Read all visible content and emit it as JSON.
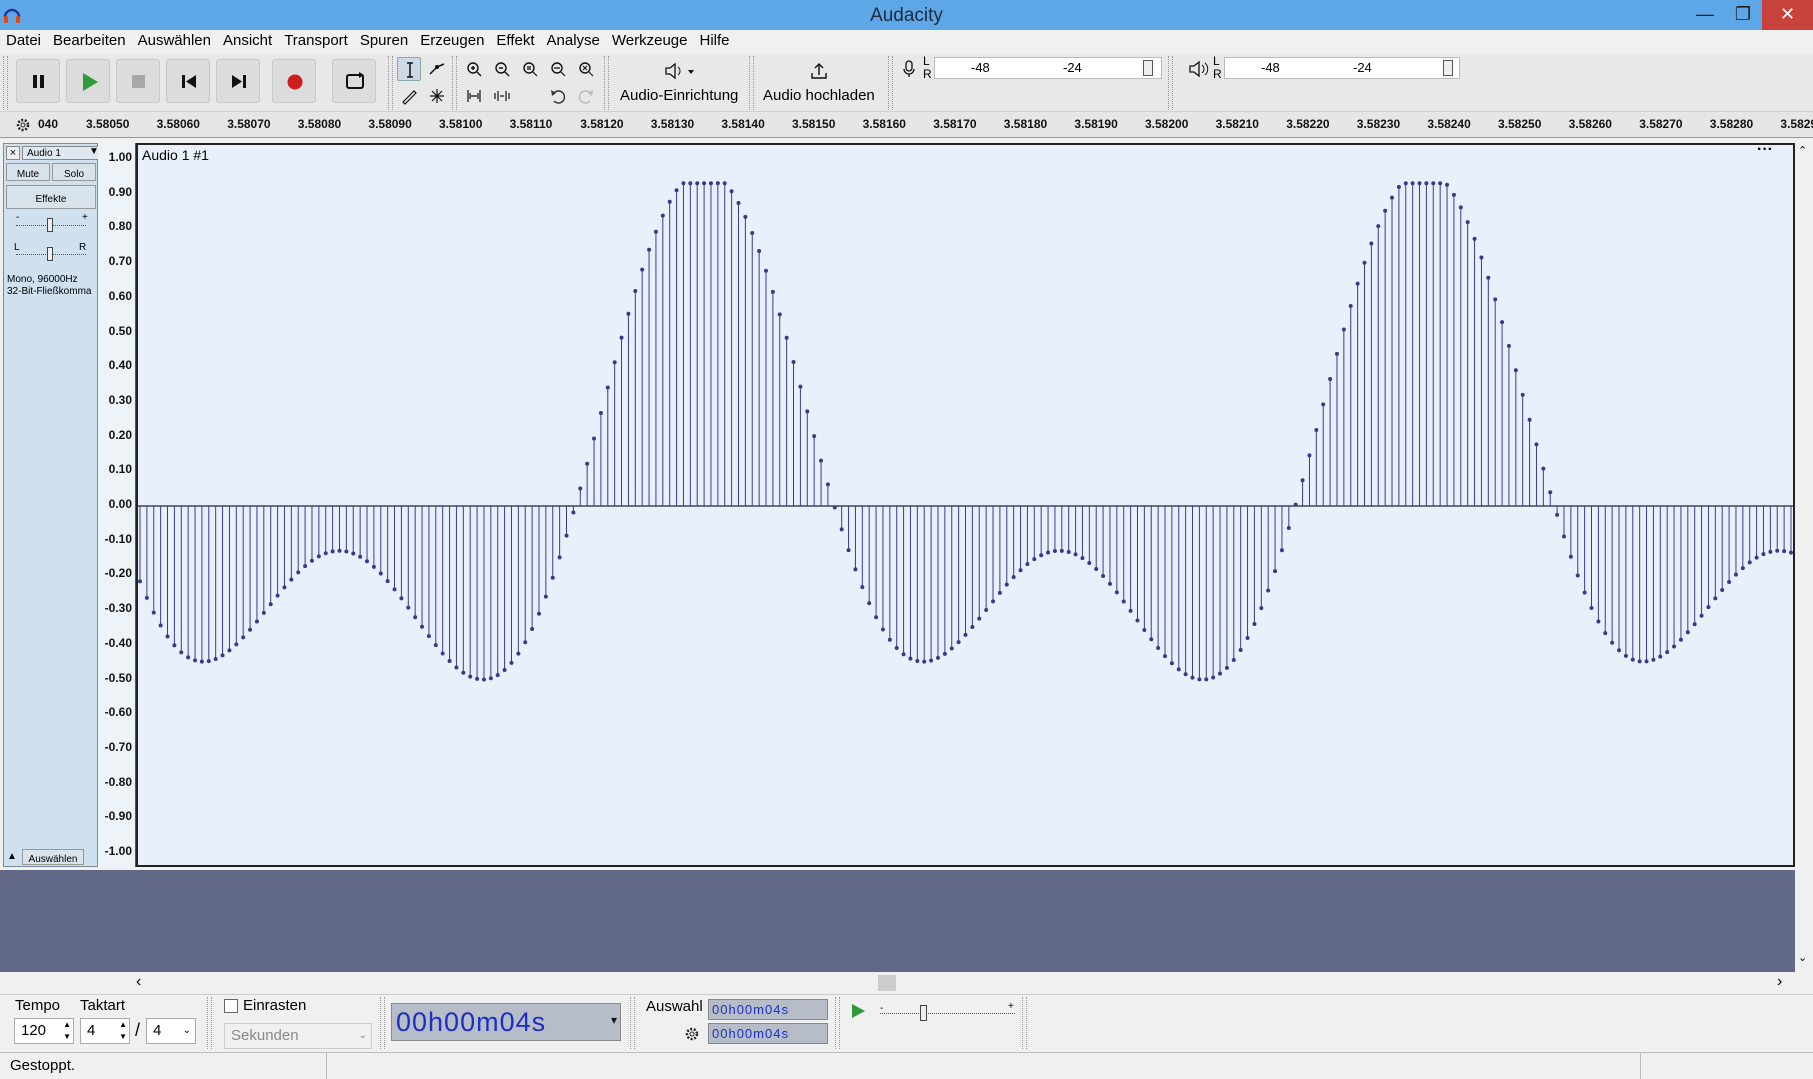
{
  "window": {
    "title": "Audacity",
    "min": "—",
    "max": "❐",
    "close": "✕"
  },
  "menu": [
    "Datei",
    "Bearbeiten",
    "Auswählen",
    "Ansicht",
    "Transport",
    "Spuren",
    "Erzeugen",
    "Effekt",
    "Analyse",
    "Werkzeuge",
    "Hilfe"
  ],
  "toolbar": {
    "audio_setup_label": "Audio-Einrichtung",
    "audio_upload_label": "Audio hochladen",
    "meter_rec_ticks": [
      "-48",
      "-24"
    ],
    "meter_play_ticks": [
      "-48",
      "-24"
    ],
    "lr_l": "L",
    "lr_r": "R"
  },
  "ruler": {
    "labels": [
      "040",
      "3.58050",
      "3.58060",
      "3.58070",
      "3.58080",
      "3.58090",
      "3.58100",
      "3.58110",
      "3.58120",
      "3.58130",
      "3.58140",
      "3.58150",
      "3.58160",
      "3.58170",
      "3.58180",
      "3.58190",
      "3.58200",
      "3.58210",
      "3.58220",
      "3.58230",
      "3.58240",
      "3.58250",
      "3.58260",
      "3.58270",
      "3.58280",
      "3.5829"
    ]
  },
  "track": {
    "name": "Audio 1",
    "clip_title": "Audio 1 #1",
    "mute": "Mute",
    "solo": "Solo",
    "effects": "Effekte",
    "gain_minus": "-",
    "gain_plus": "+",
    "pan_l": "L",
    "pan_r": "R",
    "info_line1": "Mono, 96000Hz",
    "info_line2": "32-Bit-Fließkomma",
    "select_label": "Auswählen",
    "clip_menu": "···"
  },
  "vruler": {
    "labels": [
      "1.00",
      "0.90",
      "0.80",
      "0.70",
      "0.60",
      "0.50",
      "0.40",
      "0.30",
      "0.20",
      "0.10",
      "0.00",
      "-0.10",
      "-0.20",
      "-0.30",
      "-0.40",
      "-0.50",
      "-0.60",
      "-0.70",
      "-0.80",
      "-0.90",
      "-1.00"
    ]
  },
  "waveform": {
    "start_time": 3.58045,
    "end_time": 3.5829,
    "y_range": [
      -1.0,
      1.0
    ],
    "color": "#3a3a8c"
  },
  "bottom": {
    "tempo_label": "Tempo",
    "tempo_value": "120",
    "takt_label": "Taktart",
    "takt_num": "4",
    "takt_sep": "/",
    "takt_den": "4",
    "snap_label": "Einrasten",
    "snap_unit": "Sekunden",
    "time_display": "00h00m04s",
    "selection_label": "Auswahl",
    "sel_start": "00h00m04s",
    "sel_end": "00h00m04s"
  },
  "status": {
    "text": "Gestoppt."
  }
}
